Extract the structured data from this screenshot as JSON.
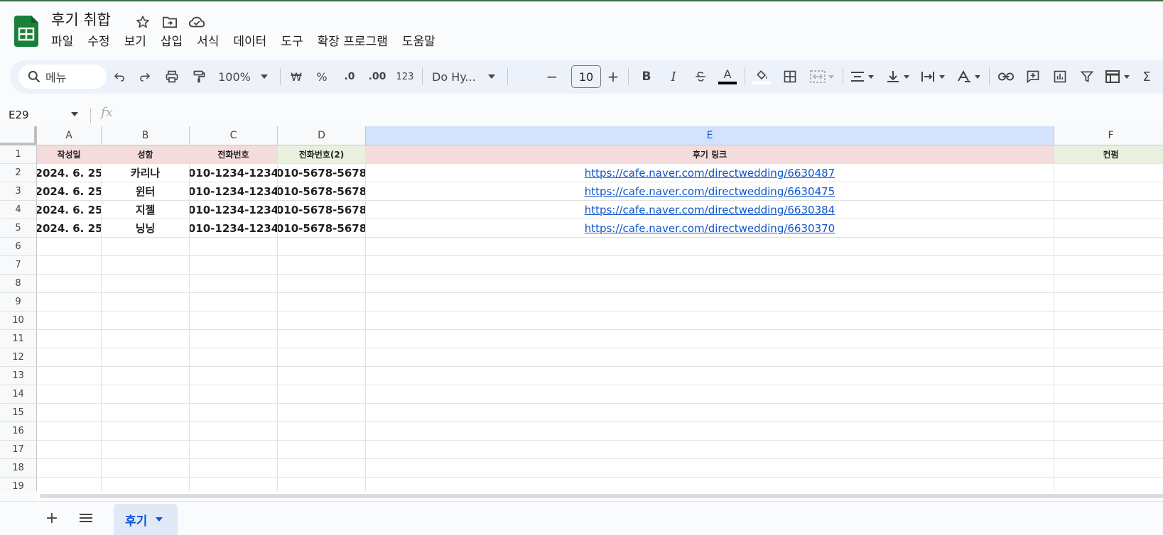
{
  "header": {
    "doc_title": "후기 취합",
    "menu": [
      "파일",
      "수정",
      "보기",
      "삽입",
      "서식",
      "데이터",
      "도구",
      "확장 프로그램",
      "도움말"
    ]
  },
  "toolbar": {
    "search_placeholder": "메뉴",
    "zoom": "100%",
    "currency": "₩",
    "percent": "%",
    "decrease_decimal": ".0",
    "increase_decimal": ".00",
    "number_format": "123",
    "font_name": "Do Hy...",
    "font_size": "10",
    "bold": "B",
    "italic": "I",
    "text_color_label": "A"
  },
  "formula_bar": {
    "cell_ref": "E29",
    "fx": "fx"
  },
  "grid": {
    "columns": [
      "A",
      "B",
      "C",
      "D",
      "E",
      "F"
    ],
    "selected_column": "E",
    "row_numbers": [
      "1",
      "2",
      "3",
      "4",
      "5",
      "6",
      "7",
      "8",
      "9",
      "10",
      "11",
      "12",
      "13",
      "14",
      "15",
      "16",
      "17",
      "18",
      "19"
    ],
    "header_row": [
      "작성일",
      "성함",
      "전화번호",
      "전화번호(2)",
      "후기 링크",
      "컨펌"
    ],
    "header_colors": [
      "#f4dcdc",
      "#f4dcdc",
      "#f4dcdc",
      "#e9f1de",
      "#f4dcdc",
      "#e9f1de"
    ],
    "rows": [
      [
        "2024. 6. 25",
        "카리나",
        "010-1234-1234",
        "010-5678-5678",
        "https://cafe.naver.com/directwedding/6630487",
        ""
      ],
      [
        "2024. 6. 25",
        "윈터",
        "010-1234-1234",
        "010-5678-5678",
        "https://cafe.naver.com/directwedding/6630475",
        ""
      ],
      [
        "2024. 6. 25",
        "지젤",
        "010-1234-1234",
        "010-5678-5678",
        "https://cafe.naver.com/directwedding/6630384",
        ""
      ],
      [
        "2024. 6. 25",
        "닝닝",
        "010-1234-1234",
        "010-5678-5678",
        "https://cafe.naver.com/directwedding/6630370",
        ""
      ]
    ]
  },
  "sheets": {
    "tabs": [
      "후기"
    ],
    "active": "후기"
  }
}
